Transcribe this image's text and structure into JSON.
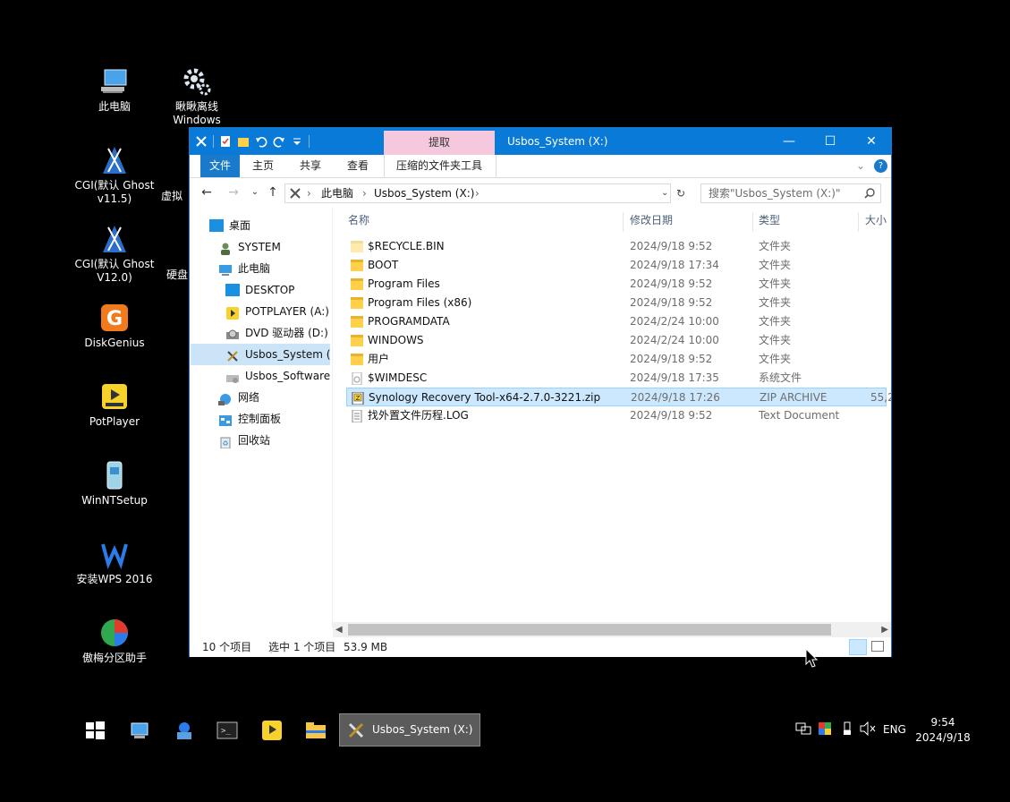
{
  "desktop": {
    "icons": [
      {
        "label": "此电脑",
        "icon": "computer-icon"
      },
      {
        "label": "瞅瞅离线\nWindows",
        "icon": "gears-icon"
      },
      {
        "label": "CGI(默认 Ghost\nv11.5)",
        "icon": "cgi-icon"
      },
      {
        "label": "虚拟",
        "icon": "partial-icon"
      },
      {
        "label": "CGI(默认 Ghost\nV12.0)",
        "icon": "cgi-icon"
      },
      {
        "label": "硬盘",
        "icon": "partial-icon"
      },
      {
        "label": "DiskGenius",
        "icon": "diskgenius-icon"
      },
      {
        "label": "PotPlayer",
        "icon": "potplayer-icon"
      },
      {
        "label": "WinNTSetup",
        "icon": "winntsetup-icon"
      },
      {
        "label": "安装WPS 2016",
        "icon": "wps-icon"
      },
      {
        "label": "傲梅分区助手",
        "icon": "aomei-icon"
      }
    ]
  },
  "window": {
    "title": "Usbos_System (X:)",
    "context_tab": "提取",
    "ribbon_tabs": [
      "文件",
      "主页",
      "共享",
      "查看",
      "压缩的文件夹工具"
    ],
    "address": {
      "crumbs": [
        "此电脑",
        "Usbos_System (X:)"
      ]
    },
    "search_placeholder": "搜索\"Usbos_System (X:)\"",
    "nav": [
      {
        "label": "桌面",
        "icon": "desktop-icon"
      },
      {
        "label": "SYSTEM",
        "icon": "user-icon"
      },
      {
        "label": "此电脑",
        "icon": "computer-icon"
      },
      {
        "label": "DESKTOP",
        "icon": "desktop-folder-icon"
      },
      {
        "label": "POTPLAYER (A:)",
        "icon": "potplayer-icon"
      },
      {
        "label": "DVD 驱动器 (D:)",
        "icon": "dvd-icon"
      },
      {
        "label": "Usbos_System (X:)",
        "icon": "usbos-drive-icon"
      },
      {
        "label": "Usbos_Software",
        "icon": "drive-icon"
      },
      {
        "label": "网络",
        "icon": "network-icon"
      },
      {
        "label": "控制面板",
        "icon": "control-panel-icon"
      },
      {
        "label": "回收站",
        "icon": "recycle-bin-icon"
      }
    ],
    "columns": [
      "名称",
      "修改日期",
      "类型",
      "大小"
    ],
    "files": [
      {
        "name": "$RECYCLE.BIN",
        "date": "2024/9/18 9:52",
        "type": "文件夹",
        "size": "",
        "kind": "folder-faded"
      },
      {
        "name": "BOOT",
        "date": "2024/9/18 17:34",
        "type": "文件夹",
        "size": "",
        "kind": "folder"
      },
      {
        "name": "Program Files",
        "date": "2024/9/18 9:52",
        "type": "文件夹",
        "size": "",
        "kind": "folder"
      },
      {
        "name": "Program Files (x86)",
        "date": "2024/9/18 9:52",
        "type": "文件夹",
        "size": "",
        "kind": "folder"
      },
      {
        "name": "PROGRAMDATA",
        "date": "2024/2/24 10:00",
        "type": "文件夹",
        "size": "",
        "kind": "folder"
      },
      {
        "name": "WINDOWS",
        "date": "2024/2/24 10:00",
        "type": "文件夹",
        "size": "",
        "kind": "folder"
      },
      {
        "name": "用户",
        "date": "2024/9/18 9:52",
        "type": "文件夹",
        "size": "",
        "kind": "folder"
      },
      {
        "name": "$WIMDESC",
        "date": "2024/9/18 17:35",
        "type": "系统文件",
        "size": "",
        "kind": "sysfile"
      },
      {
        "name": "Synology Recovery Tool-x64-2.7.0-3221.zip",
        "date": "2024/9/18 17:26",
        "type": "ZIP ARCHIVE",
        "size": "55,2",
        "kind": "zip"
      },
      {
        "name": "找外置文件历程.LOG",
        "date": "2024/9/18 9:52",
        "type": "Text Document",
        "size": "",
        "kind": "text"
      }
    ],
    "status": {
      "count": "10 个项目",
      "selected": "选中 1 个项目",
      "size": "53.9 MB"
    }
  },
  "taskbar": {
    "active_label": "Usbos_System (X:)",
    "lang": "ENG",
    "time": "9:54",
    "date": "2024/9/18"
  },
  "colors": {
    "title_blue": "#0a7ad8",
    "context_pink": "#f6c8dd",
    "select_blue": "#cce8ff"
  }
}
